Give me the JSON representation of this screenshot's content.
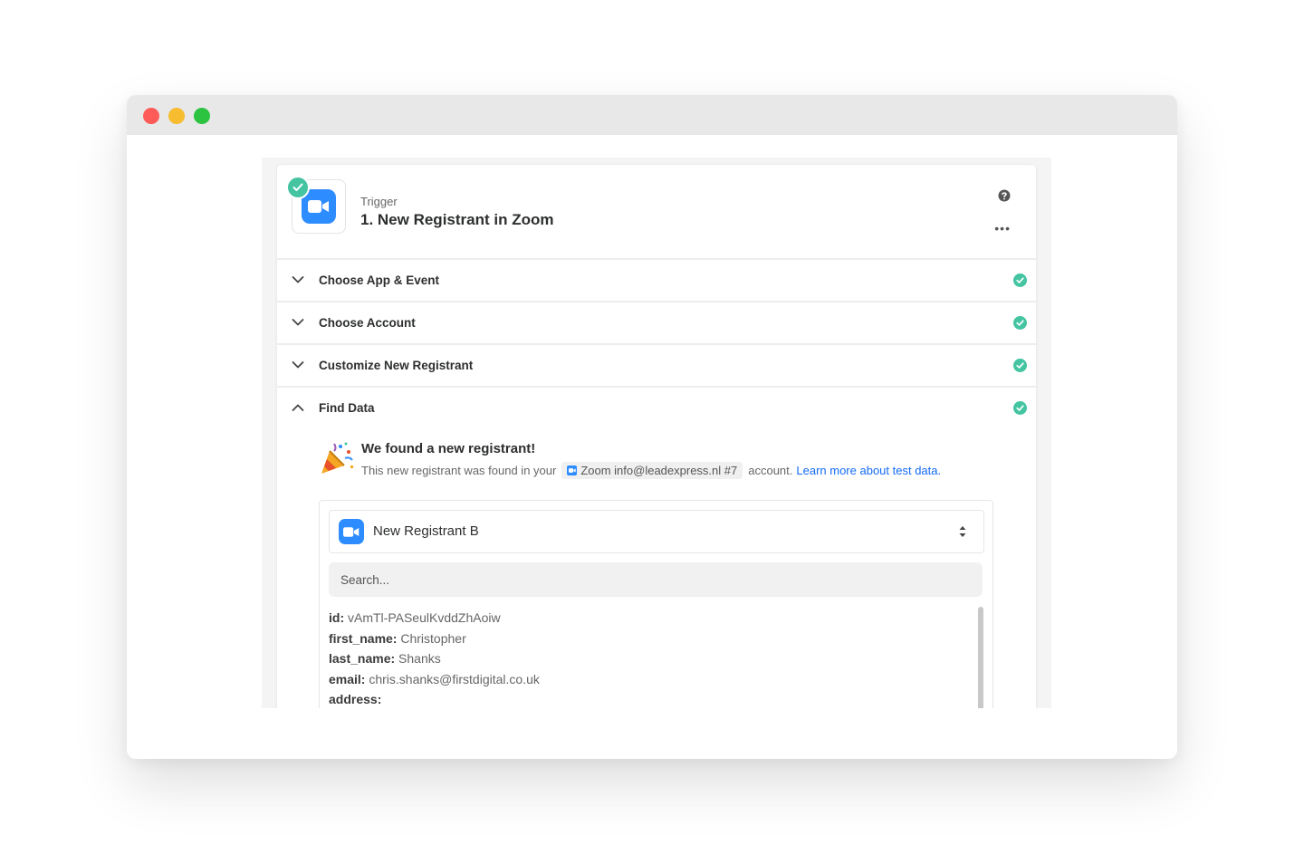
{
  "window": {
    "controls": [
      "close",
      "minimize",
      "zoom"
    ]
  },
  "step": {
    "type_label": "Trigger",
    "title": "1. New Registrant in Zoom",
    "app_icon": "zoom-camera-icon",
    "more_label": "•••"
  },
  "sections": [
    {
      "label": "Choose App & Event",
      "state": "collapsed",
      "complete": true
    },
    {
      "label": "Choose Account",
      "state": "collapsed",
      "complete": true
    },
    {
      "label": "Customize New Registrant",
      "state": "collapsed",
      "complete": true
    },
    {
      "label": "Find Data",
      "state": "expanded",
      "complete": true
    }
  ],
  "find_data": {
    "title": "We found a new registrant!",
    "text_before": "This new registrant was found in your",
    "account_pill": "Zoom info@leadexpress.nl #7",
    "text_after": "account.",
    "link": "Learn more about test data.",
    "selected_record": "New Registrant B",
    "search_placeholder": "Search...",
    "fields": [
      {
        "key": "id:",
        "value": "vAmTl-PASeulKvddZhAoiw"
      },
      {
        "key": "first_name:",
        "value": "Christopher"
      },
      {
        "key": "last_name:",
        "value": "Shanks"
      },
      {
        "key": "email:",
        "value": "chris.shanks@firstdigital.co.uk"
      },
      {
        "key": "address:",
        "value": ""
      }
    ]
  },
  "colors": {
    "accent_blue": "#2d8cff",
    "success_green": "#44c4a1",
    "link_blue": "#136bf5"
  }
}
